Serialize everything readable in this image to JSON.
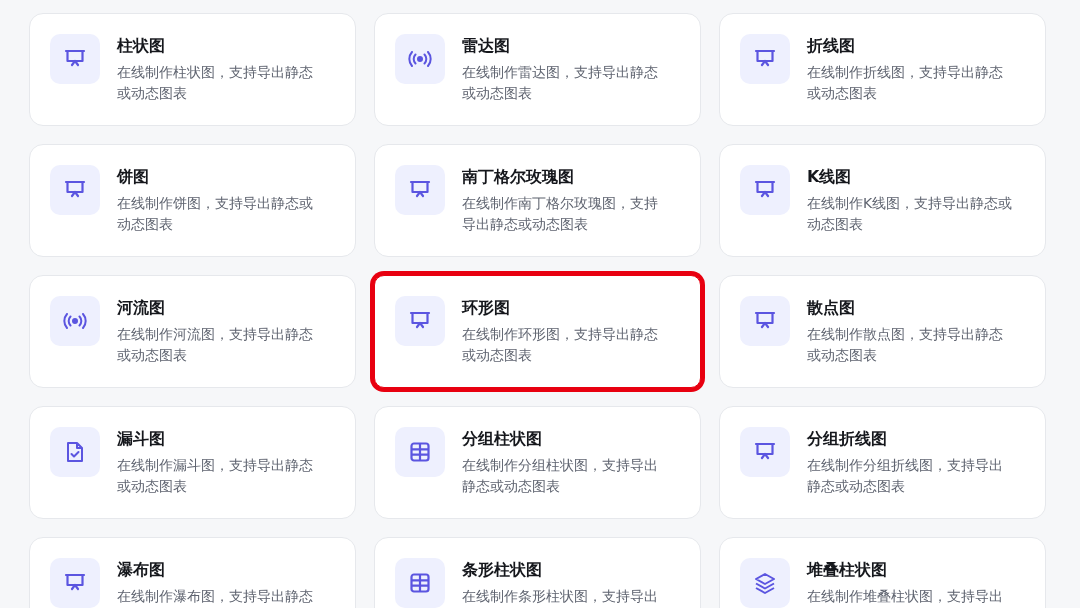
{
  "cards": [
    {
      "title": "柱状图",
      "description": "在线制作柱状图，支持导出静态或动态图表",
      "kind": "presentation",
      "highlighted": false
    },
    {
      "title": "雷达图",
      "description": "在线制作雷达图，支持导出静态或动态图表",
      "kind": "signal",
      "highlighted": false
    },
    {
      "title": "折线图",
      "description": "在线制作折线图，支持导出静态或动态图表",
      "kind": "presentation",
      "highlighted": false
    },
    {
      "title": "饼图",
      "description": "在线制作饼图，支持导出静态或动态图表",
      "kind": "presentation",
      "highlighted": false
    },
    {
      "title": "南丁格尔玫瑰图",
      "description": "在线制作南丁格尔玫瑰图，支持导出静态或动态图表",
      "kind": "presentation",
      "highlighted": false
    },
    {
      "title": "K线图",
      "description": "在线制作K线图，支持导出静态或动态图表",
      "kind": "presentation",
      "highlighted": false
    },
    {
      "title": "河流图",
      "description": "在线制作河流图，支持导出静态或动态图表",
      "kind": "signal",
      "highlighted": false
    },
    {
      "title": "环形图",
      "description": "在线制作环形图，支持导出静态或动态图表",
      "kind": "presentation",
      "highlighted": true
    },
    {
      "title": "散点图",
      "description": "在线制作散点图，支持导出静态或动态图表",
      "kind": "presentation",
      "highlighted": false
    },
    {
      "title": "漏斗图",
      "description": "在线制作漏斗图，支持导出静态或动态图表",
      "kind": "file-check",
      "highlighted": false
    },
    {
      "title": "分组柱状图",
      "description": "在线制作分组柱状图，支持导出静态或动态图表",
      "kind": "table",
      "highlighted": false
    },
    {
      "title": "分组折线图",
      "description": "在线制作分组折线图，支持导出静态或动态图表",
      "kind": "presentation",
      "highlighted": false
    },
    {
      "title": "瀑布图",
      "description": "在线制作瀑布图，支持导出静态",
      "kind": "presentation",
      "highlighted": false
    },
    {
      "title": "条形柱状图",
      "description": "在线制作条形柱状图，支持导出",
      "kind": "table",
      "highlighted": false
    },
    {
      "title": "堆叠柱状图",
      "description": "在线制作堆叠柱状图，支持导出",
      "kind": "layers",
      "highlighted": false
    }
  ]
}
